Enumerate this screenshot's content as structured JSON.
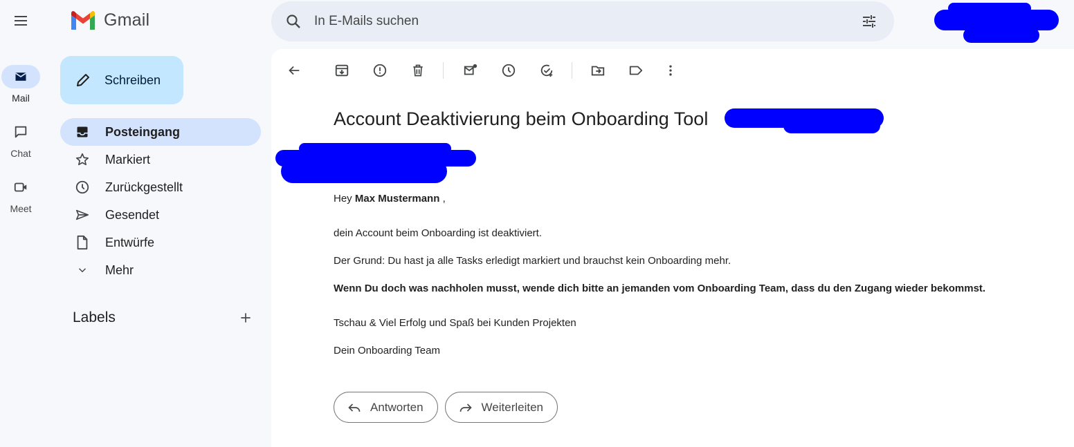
{
  "app": {
    "name": "Gmail"
  },
  "search": {
    "placeholder": "In E-Mails suchen"
  },
  "rail": {
    "items": [
      {
        "label": "Mail",
        "icon": "mail-icon",
        "active": true
      },
      {
        "label": "Chat",
        "icon": "chat-icon",
        "active": false
      },
      {
        "label": "Meet",
        "icon": "video-icon",
        "active": false
      }
    ]
  },
  "compose": {
    "label": "Schreiben"
  },
  "nav": {
    "items": [
      {
        "label": "Posteingang",
        "icon": "inbox-icon",
        "active": true
      },
      {
        "label": "Markiert",
        "icon": "star-icon"
      },
      {
        "label": "Zurückgestellt",
        "icon": "clock-icon"
      },
      {
        "label": "Gesendet",
        "icon": "send-icon"
      },
      {
        "label": "Entwürfe",
        "icon": "draft-icon"
      },
      {
        "label": "Mehr",
        "icon": "chevron-down-icon"
      }
    ]
  },
  "labels": {
    "title": "Labels"
  },
  "email": {
    "subject": "Account Deaktivierung beim Onboarding Tool",
    "greeting_prefix": "Hey",
    "greeting_name": "Max Mustermann",
    "greeting_suffix": ",",
    "line1": "dein Account beim Onboarding ist deaktiviert.",
    "line2": "Der Grund: Du hast ja alle Tasks erledigt markiert und brauchst kein Onboarding mehr.",
    "line3": "Wenn Du doch was nachholen musst, wende dich bitte an jemanden vom Onboarding Team, dass du den Zugang wieder bekommst.",
    "line4": "Tschau & Viel Erfolg und Spaß bei Kunden Projekten",
    "signature": "Dein Onboarding Team"
  },
  "actions": {
    "reply": "Antworten",
    "forward": "Weiterleiten"
  },
  "colors": {
    "redaction": "#0000ff",
    "accent": "#d3e3fd",
    "compose": "#c2e7ff"
  }
}
